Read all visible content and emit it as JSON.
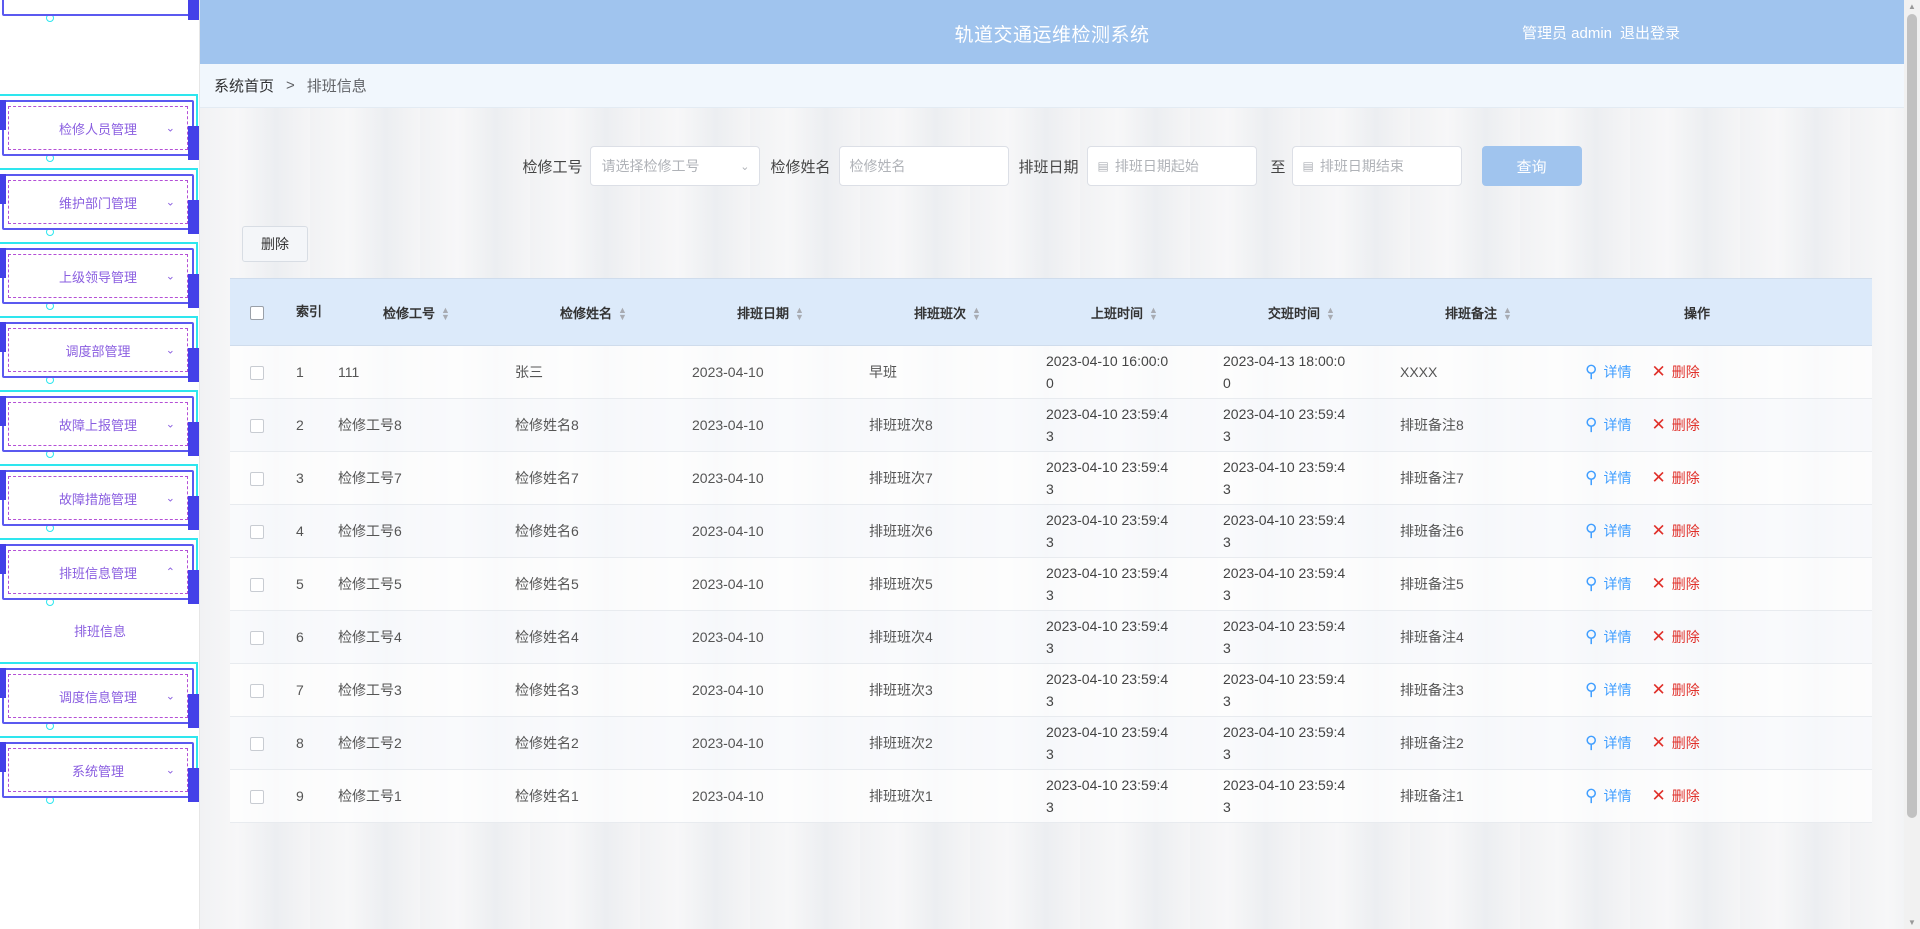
{
  "header": {
    "title": "轨道交通运维检测系统",
    "user": "管理员 admin",
    "logout": "退出登录"
  },
  "breadcrumb": {
    "home": "系统首页",
    "separator": ">",
    "current": "排班信息"
  },
  "sidebar": {
    "items": [
      {
        "label": "检修人员管理"
      },
      {
        "label": "维护部门管理"
      },
      {
        "label": "上级领导管理"
      },
      {
        "label": "调度部管理"
      },
      {
        "label": "故障上报管理"
      },
      {
        "label": "故障措施管理"
      },
      {
        "label": "排班信息管理"
      },
      {
        "label": "调度信息管理"
      },
      {
        "label": "系统管理"
      }
    ],
    "submenu": {
      "label": "排班信息"
    }
  },
  "search": {
    "worker_id_label": "检修工号",
    "worker_id_placeholder": "请选择检修工号",
    "worker_name_label": "检修姓名",
    "worker_name_placeholder": "检修姓名",
    "date_label": "排班日期",
    "date_start_placeholder": "排班日期起始",
    "to": "至",
    "date_end_placeholder": "排班日期结束",
    "query_button": "查询"
  },
  "toolbar": {
    "delete_button": "删除"
  },
  "table": {
    "headers": {
      "index": "索引",
      "worker_id": "检修工号",
      "worker_name": "检修姓名",
      "date": "排班日期",
      "shift": "排班班次",
      "on_time": "上班时间",
      "off_time": "交班时间",
      "note": "排班备注",
      "ops": "操作"
    },
    "ops": {
      "detail": "详情",
      "delete": "删除"
    },
    "rows": [
      {
        "index": "1",
        "worker_id": "111",
        "worker_name": "张三",
        "date": "2023-04-10",
        "shift": "早班",
        "on_time_1": "2023-04-10 16:00:0",
        "on_time_2": "0",
        "off_time_1": "2023-04-13 18:00:0",
        "off_time_2": "0",
        "note": "XXXX"
      },
      {
        "index": "2",
        "worker_id": "检修工号8",
        "worker_name": "检修姓名8",
        "date": "2023-04-10",
        "shift": "排班班次8",
        "on_time_1": "2023-04-10 23:59:4",
        "on_time_2": "3",
        "off_time_1": "2023-04-10 23:59:4",
        "off_time_2": "3",
        "note": "排班备注8"
      },
      {
        "index": "3",
        "worker_id": "检修工号7",
        "worker_name": "检修姓名7",
        "date": "2023-04-10",
        "shift": "排班班次7",
        "on_time_1": "2023-04-10 23:59:4",
        "on_time_2": "3",
        "off_time_1": "2023-04-10 23:59:4",
        "off_time_2": "3",
        "note": "排班备注7"
      },
      {
        "index": "4",
        "worker_id": "检修工号6",
        "worker_name": "检修姓名6",
        "date": "2023-04-10",
        "shift": "排班班次6",
        "on_time_1": "2023-04-10 23:59:4",
        "on_time_2": "3",
        "off_time_1": "2023-04-10 23:59:4",
        "off_time_2": "3",
        "note": "排班备注6"
      },
      {
        "index": "5",
        "worker_id": "检修工号5",
        "worker_name": "检修姓名5",
        "date": "2023-04-10",
        "shift": "排班班次5",
        "on_time_1": "2023-04-10 23:59:4",
        "on_time_2": "3",
        "off_time_1": "2023-04-10 23:59:4",
        "off_time_2": "3",
        "note": "排班备注5"
      },
      {
        "index": "6",
        "worker_id": "检修工号4",
        "worker_name": "检修姓名4",
        "date": "2023-04-10",
        "shift": "排班班次4",
        "on_time_1": "2023-04-10 23:59:4",
        "on_time_2": "3",
        "off_time_1": "2023-04-10 23:59:4",
        "off_time_2": "3",
        "note": "排班备注4"
      },
      {
        "index": "7",
        "worker_id": "检修工号3",
        "worker_name": "检修姓名3",
        "date": "2023-04-10",
        "shift": "排班班次3",
        "on_time_1": "2023-04-10 23:59:4",
        "on_time_2": "3",
        "off_time_1": "2023-04-10 23:59:4",
        "off_time_2": "3",
        "note": "排班备注3"
      },
      {
        "index": "8",
        "worker_id": "检修工号2",
        "worker_name": "检修姓名2",
        "date": "2023-04-10",
        "shift": "排班班次2",
        "on_time_1": "2023-04-10 23:59:4",
        "on_time_2": "3",
        "off_time_1": "2023-04-10 23:59:4",
        "off_time_2": "3",
        "note": "排班备注2"
      },
      {
        "index": "9",
        "worker_id": "检修工号1",
        "worker_name": "检修姓名1",
        "date": "2023-04-10",
        "shift": "排班班次1",
        "on_time_1": "2023-04-10 23:59:4",
        "on_time_2": "3",
        "off_time_1": "2023-04-10 23:59:4",
        "off_time_2": "3",
        "note": "排班备注1"
      }
    ]
  }
}
